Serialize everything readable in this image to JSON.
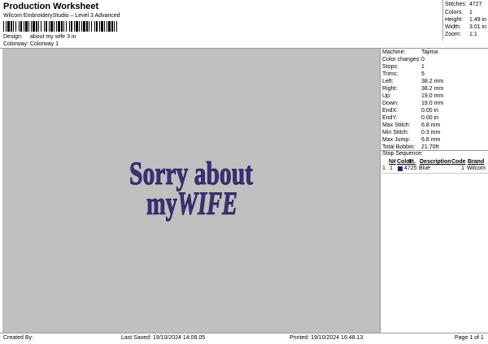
{
  "header": {
    "title": "Production Worksheet",
    "subtitle": "Wilcom EmbroideryStudio – Level 3 Advanced",
    "design_label": "Design:",
    "design_value": "about my wife 3 in",
    "colorway_label": "Colorway:",
    "colorway_value": "Colorway 1"
  },
  "summary": {
    "stitches_label": "Stitches:",
    "stitches_value": "4727",
    "colors_label": "Colors:",
    "colors_value": "1",
    "height_label": "Height:",
    "height_value": "1.49 in",
    "width_label": "Width:",
    "width_value": "3.01 in",
    "zoom_label": "Zoom:",
    "zoom_value": "1:1"
  },
  "design": {
    "line1": "Sorry about",
    "line2a": "my",
    "line2b": "WIFE",
    "thread_color": "#3b3276",
    "canvas_color": "#c0c0c0"
  },
  "machine": [
    {
      "label": "Machine:",
      "value": "Tajima"
    },
    {
      "label": "Color changes:",
      "value": "0"
    },
    {
      "label": "Stops:",
      "value": "1"
    },
    {
      "label": "Trims:",
      "value": "5"
    },
    {
      "label": "Left:",
      "value": "38.2 mm"
    },
    {
      "label": "Right:",
      "value": "38.2 mm"
    },
    {
      "label": "Up:",
      "value": "19.0 mm"
    },
    {
      "label": "Down:",
      "value": "19.0 mm"
    },
    {
      "label": "EndX:",
      "value": "0.00 in"
    },
    {
      "label": "EndY:",
      "value": "0.00 in"
    },
    {
      "label": "Max Stitch:",
      "value": "6.8 mm"
    },
    {
      "label": "Min Stitch:",
      "value": "0.3 mm"
    },
    {
      "label": "Max Jump:",
      "value": "6.8 mm"
    },
    {
      "label": "Total Bobbin:",
      "value": "21.70ft"
    }
  ],
  "stop_sequence": {
    "title": "Stop Sequence:",
    "headers": {
      "n": "N#",
      "color": "Color",
      "stitches": "St.",
      "description": "Description",
      "code": "Code",
      "brand": "Brand"
    },
    "rows": [
      {
        "stop": "1",
        "n": "1",
        "swatch": "#2a2270",
        "stitches": "4725",
        "description": "Blue",
        "code": "1",
        "brand": "Wilcom"
      }
    ]
  },
  "footer": {
    "created_by": "Created By:",
    "last_saved": "Last Saved: 19/10/2024 14:08.05",
    "printed": "Printed: 19/10/2024 16:48.13",
    "page": "Page 1 of 1"
  }
}
